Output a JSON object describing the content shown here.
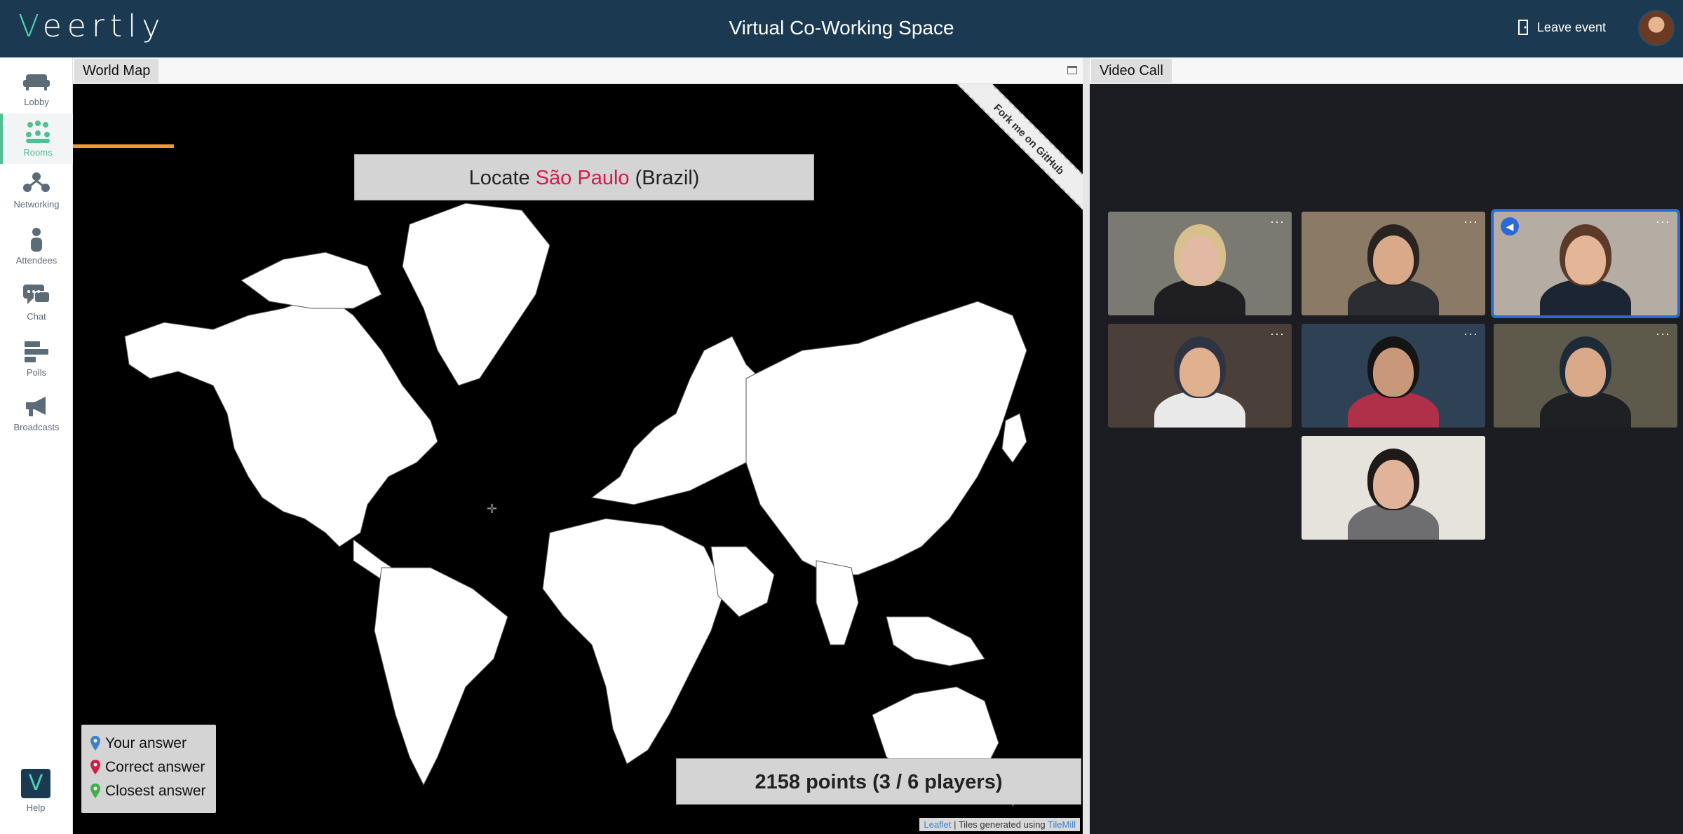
{
  "topbar": {
    "logo_prefix": "V",
    "logo_rest": "eertly",
    "title": "Virtual Co-Working Space",
    "leave_label": "Leave event"
  },
  "sidebar": {
    "items": [
      {
        "label": "Lobby",
        "icon": "sofa-icon"
      },
      {
        "label": "Rooms",
        "icon": "rooms-icon",
        "active": true
      },
      {
        "label": "Networking",
        "icon": "networking-icon"
      },
      {
        "label": "Attendees",
        "icon": "person-icon"
      },
      {
        "label": "Chat",
        "icon": "chat-icon"
      },
      {
        "label": "Polls",
        "icon": "polls-icon"
      },
      {
        "label": "Broadcasts",
        "icon": "megaphone-icon"
      }
    ],
    "help_label": "Help",
    "help_glyph": "V"
  },
  "world_map": {
    "tab_label": "World Map",
    "prompt_prefix": "Locate ",
    "prompt_city": "São Paulo",
    "prompt_suffix": " (Brazil)",
    "ribbon_text": "Fork me on GitHub",
    "legend": [
      {
        "label": "Your answer",
        "color": "#3a83c6"
      },
      {
        "label": "Correct answer",
        "color": "#d51a4a"
      },
      {
        "label": "Closest answer",
        "color": "#3fb04a"
      }
    ],
    "score_text": "2158 points (3 / 6 players)",
    "attribution_leaflet": "Leaflet",
    "attribution_sep": " | Tiles generated using ",
    "attribution_tilemill": "TileMill"
  },
  "video_call": {
    "tab_label": "Video Call",
    "more_glyph": "···",
    "participants": [
      {
        "bg": "#7a7a72",
        "skin": "#e2b9a2",
        "hair": "#d8c08c",
        "shirt": "#1f1f22"
      },
      {
        "bg": "#8a7a66",
        "skin": "#d9a98a",
        "hair": "#2a2421",
        "shirt": "#2b2d33"
      },
      {
        "bg": "#b5aca4",
        "skin": "#e4b596",
        "hair": "#5b3a27",
        "shirt": "#1b2533",
        "speaking": true
      },
      {
        "bg": "#4a3f39",
        "skin": "#e0b08f",
        "hair": "#2f3443",
        "shirt": "#e9e9ea"
      },
      {
        "bg": "#2f4255",
        "skin": "#c9987a",
        "hair": "#151515",
        "shirt": "#b0304a"
      },
      {
        "bg": "#5d5a4c",
        "skin": "#d9a98a",
        "hair": "#1e2a36",
        "shirt": "#1e2024"
      },
      {
        "bg": "#e6e2dc",
        "skin": "#e0b39a",
        "hair": "#1f1917",
        "shirt": "#6e6e70"
      }
    ]
  }
}
